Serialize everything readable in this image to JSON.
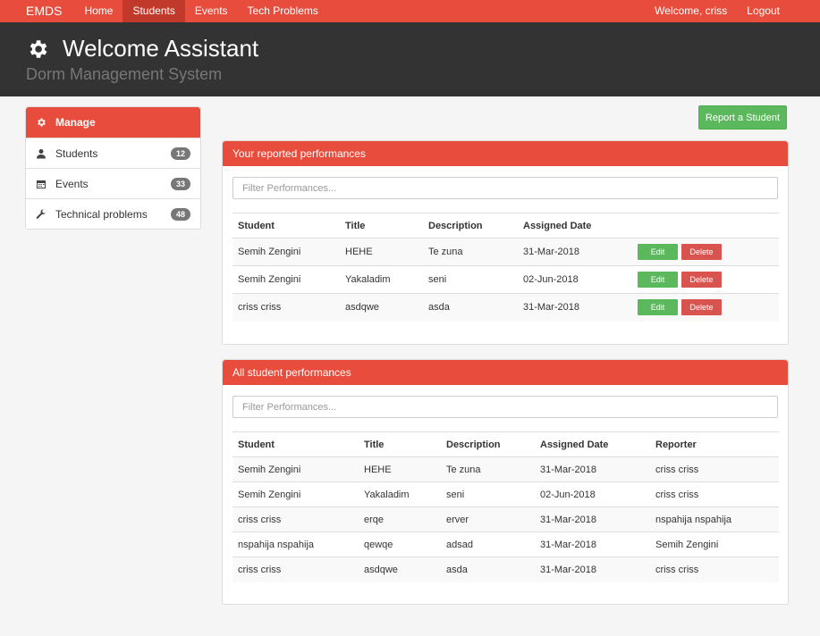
{
  "navbar": {
    "brand": "EMDS",
    "items": [
      "Home",
      "Students",
      "Events",
      "Tech Problems"
    ],
    "welcome": "Welcome, criss",
    "logout": "Logout"
  },
  "header": {
    "title": "Welcome Assistant",
    "subtitle": "Dorm Management System",
    "icon": "gear-icon"
  },
  "sidebar": {
    "head": "Manage",
    "items": [
      {
        "label": "Students",
        "count": "12",
        "icon": "user-icon"
      },
      {
        "label": "Events",
        "count": "33",
        "icon": "calendar-icon"
      },
      {
        "label": "Technical problems",
        "count": "48",
        "icon": "wrench-icon"
      }
    ]
  },
  "report_button": "Report a Student",
  "panel1": {
    "title": "Your reported performances",
    "filter_placeholder": "Filter Performances...",
    "columns": [
      "Student",
      "Title",
      "Description",
      "Assigned Date"
    ],
    "edit_label": "Edit",
    "delete_label": "Delete",
    "rows": [
      [
        "Semih Zengini",
        "HEHE",
        "Te zuna",
        "31-Mar-2018"
      ],
      [
        "Semih Zengini",
        "Yakaladim",
        "seni",
        "02-Jun-2018"
      ],
      [
        "criss criss",
        "asdqwe",
        "asda",
        "31-Mar-2018"
      ]
    ]
  },
  "panel2": {
    "title": "All student performances",
    "filter_placeholder": "Filter Performances...",
    "columns": [
      "Student",
      "Title",
      "Description",
      "Assigned Date",
      "Reporter"
    ],
    "rows": [
      [
        "Semih Zengini",
        "HEHE",
        "Te zuna",
        "31-Mar-2018",
        "criss criss"
      ],
      [
        "Semih Zengini",
        "Yakaladim",
        "seni",
        "02-Jun-2018",
        "criss criss"
      ],
      [
        "criss criss",
        "erqe",
        "erver",
        "31-Mar-2018",
        "nspahija nspahija"
      ],
      [
        "nspahija nspahija",
        "qewqe",
        "adsad",
        "31-Mar-2018",
        "Semih Zengini"
      ],
      [
        "criss criss",
        "asdqwe",
        "asda",
        "31-Mar-2018",
        "criss criss"
      ]
    ]
  }
}
